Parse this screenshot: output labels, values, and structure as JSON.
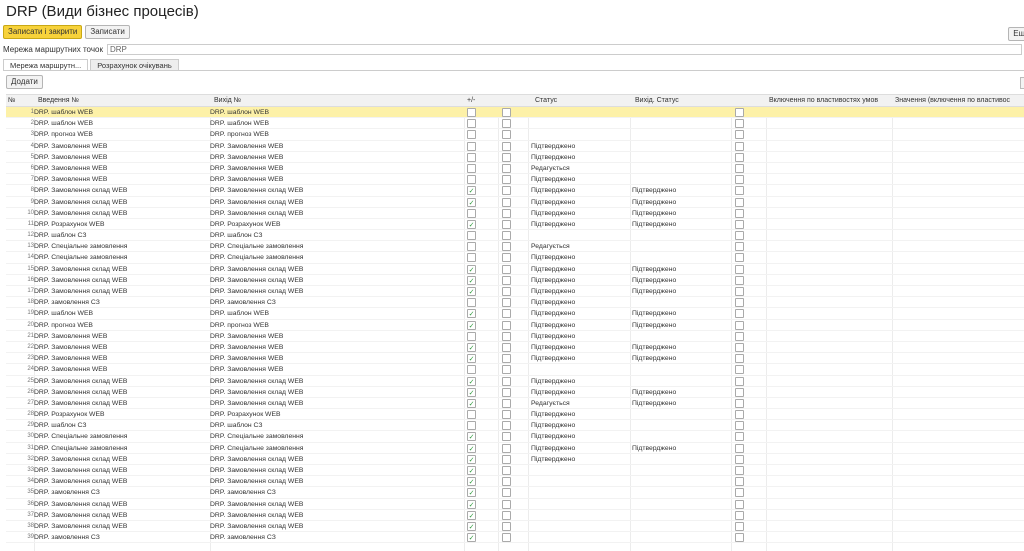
{
  "window": {
    "title": "DRP (Види бізнес процесів)"
  },
  "toolbar": {
    "save_close": "Записати і закрити",
    "save": "Записати",
    "right_button": "Еш"
  },
  "route_network": {
    "label": "Мережа маршрутних точок",
    "value": "DRP"
  },
  "tabs": [
    {
      "label": "Мережа маршрутн..."
    },
    {
      "label": "Розрахунок очікувань"
    }
  ],
  "add_button": "Додати",
  "columns": {
    "num": "№",
    "input": "Введення №",
    "output": "Вихід №",
    "c1": "+/-",
    "c2": "",
    "status": "Статус",
    "exit_status": "Вихід. Статус",
    "c3": "",
    "incl": "Включення по властивостях умов",
    "val": "Значення (включення по властивос"
  },
  "rows": [
    {
      "n": "1",
      "in": "DRP. шаблон WEB",
      "out": "DRP. шаблон WEB",
      "c1": false,
      "st": "",
      "ex": ""
    },
    {
      "n": "2",
      "in": "DRP. шаблон WEB",
      "out": "DRP. шаблон WEB",
      "c1": false,
      "st": "",
      "ex": ""
    },
    {
      "n": "3",
      "in": "DRP. прогноз WEB",
      "out": "DRP. прогноз WEB",
      "c1": false,
      "st": "",
      "ex": ""
    },
    {
      "n": "4",
      "in": "DRP. Замовлення WEB",
      "out": "DRP. Замовлення WEB",
      "c1": false,
      "st": "Підтверджено",
      "ex": ""
    },
    {
      "n": "5",
      "in": "DRP. Замовлення WEB",
      "out": "DRP. Замовлення WEB",
      "c1": false,
      "st": "Підтверджено",
      "ex": ""
    },
    {
      "n": "6",
      "in": "DRP. Замовлення WEB",
      "out": "DRP. Замовлення WEB",
      "c1": false,
      "st": "Редагується",
      "ex": ""
    },
    {
      "n": "7",
      "in": "DRP. Замовлення WEB",
      "out": "DRP. Замовлення WEB",
      "c1": false,
      "st": "Підтверджено",
      "ex": ""
    },
    {
      "n": "8",
      "in": "DRP. Замовлення склад WEB",
      "out": "DRP. Замовлення склад WEB",
      "c1": true,
      "st": "Підтверджено",
      "ex": "Підтверджено"
    },
    {
      "n": "9",
      "in": "DRP. Замовлення склад WEB",
      "out": "DRP. Замовлення склад WEB",
      "c1": true,
      "st": "Підтверджено",
      "ex": "Підтверджено"
    },
    {
      "n": "10",
      "in": "DRP. Замовлення склад WEB",
      "out": "DRP. Замовлення склад WEB",
      "c1": false,
      "st": "Підтверджено",
      "ex": "Підтверджено"
    },
    {
      "n": "11",
      "in": "DRP. Розрахунок WEB",
      "out": "DRP. Розрахунок WEB",
      "c1": true,
      "st": "Підтверджено",
      "ex": "Підтверджено"
    },
    {
      "n": "12",
      "in": "DRP. шаблон СЗ",
      "out": "DRP. шаблон СЗ",
      "c1": false,
      "st": "",
      "ex": ""
    },
    {
      "n": "13",
      "in": "DRP. Спеціальне замовлення",
      "out": "DRP. Спеціальне замовлення",
      "c1": false,
      "st": "Редагується",
      "ex": ""
    },
    {
      "n": "14",
      "in": "DRP. Спеціальне замовлення",
      "out": "DRP. Спеціальне замовлення",
      "c1": false,
      "st": "Підтверджено",
      "ex": ""
    },
    {
      "n": "15",
      "in": "DRP. Замовлення склад WEB",
      "out": "DRP. Замовлення склад WEB",
      "c1": true,
      "st": "Підтверджено",
      "ex": "Підтверджено"
    },
    {
      "n": "16",
      "in": "DRP. Замовлення склад WEB",
      "out": "DRP. Замовлення склад WEB",
      "c1": true,
      "st": "Підтверджено",
      "ex": "Підтверджено"
    },
    {
      "n": "17",
      "in": "DRP. Замовлення склад WEB",
      "out": "DRP. Замовлення склад WEB",
      "c1": true,
      "st": "Підтверджено",
      "ex": "Підтверджено"
    },
    {
      "n": "18",
      "in": "DRP. замовлення СЗ",
      "out": "DRP. замовлення СЗ",
      "c1": false,
      "st": "Підтверджено",
      "ex": ""
    },
    {
      "n": "19",
      "in": "DRP. шаблон WEB",
      "out": "DRP. шаблон WEB",
      "c1": true,
      "st": "Підтверджено",
      "ex": "Підтверджено"
    },
    {
      "n": "20",
      "in": "DRP. прогноз WEB",
      "out": "DRP. прогноз WEB",
      "c1": true,
      "st": "Підтверджено",
      "ex": "Підтверджено"
    },
    {
      "n": "21",
      "in": "DRP. Замовлення WEB",
      "out": "DRP. Замовлення WEB",
      "c1": false,
      "st": "Підтверджено",
      "ex": ""
    },
    {
      "n": "22",
      "in": "DRP. Замовлення WEB",
      "out": "DRP. Замовлення WEB",
      "c1": true,
      "st": "Підтверджено",
      "ex": "Підтверджено"
    },
    {
      "n": "23",
      "in": "DRP. Замовлення WEB",
      "out": "DRP. Замовлення WEB",
      "c1": true,
      "st": "Підтверджено",
      "ex": "Підтверджено"
    },
    {
      "n": "24",
      "in": "DRP. Замовлення WEB",
      "out": "DRP. Замовлення WEB",
      "c1": false,
      "st": "",
      "ex": ""
    },
    {
      "n": "25",
      "in": "DRP. Замовлення склад WEB",
      "out": "DRP. Замовлення склад WEB",
      "c1": true,
      "st": "Підтверджено",
      "ex": ""
    },
    {
      "n": "26",
      "in": "DRP. Замовлення склад WEB",
      "out": "DRP. Замовлення склад WEB",
      "c1": true,
      "st": "Підтверджено",
      "ex": "Підтверджено"
    },
    {
      "n": "27",
      "in": "DRP. Замовлення склад WEB",
      "out": "DRP. Замовлення склад WEB",
      "c1": true,
      "st": "Редагується",
      "ex": "Підтверджено"
    },
    {
      "n": "28",
      "in": "DRP. Розрахунок WEB",
      "out": "DRP. Розрахунок WEB",
      "c1": false,
      "st": "Підтверджено",
      "ex": ""
    },
    {
      "n": "29",
      "in": "DRP. шаблон СЗ",
      "out": "DRP. шаблон СЗ",
      "c1": false,
      "st": "Підтверджено",
      "ex": ""
    },
    {
      "n": "30",
      "in": "DRP. Спеціальне замовлення",
      "out": "DRP. Спеціальне замовлення",
      "c1": true,
      "st": "Підтверджено",
      "ex": ""
    },
    {
      "n": "31",
      "in": "DRP. Спеціальне замовлення",
      "out": "DRP. Спеціальне замовлення",
      "c1": true,
      "st": "Підтверджено",
      "ex": "Підтверджено"
    },
    {
      "n": "32",
      "in": "DRP. Замовлення склад WEB",
      "out": "DRP. Замовлення склад WEB",
      "c1": true,
      "st": "Підтверджено",
      "ex": ""
    },
    {
      "n": "33",
      "in": "DRP. Замовлення склад WEB",
      "out": "DRP. Замовлення склад WEB",
      "c1": true,
      "st": "",
      "ex": ""
    },
    {
      "n": "34",
      "in": "DRP. Замовлення склад WEB",
      "out": "DRP. Замовлення склад WEB",
      "c1": true,
      "st": "",
      "ex": ""
    },
    {
      "n": "35",
      "in": "DRP. замовлення СЗ",
      "out": "DRP. замовлення СЗ",
      "c1": true,
      "st": "",
      "ex": ""
    },
    {
      "n": "36",
      "in": "DRP. Замовлення склад WEB",
      "out": "DRP. Замовлення склад WEB",
      "c1": true,
      "st": "",
      "ex": ""
    },
    {
      "n": "37",
      "in": "DRP. Замовлення склад WEB",
      "out": "DRP. Замовлення склад WEB",
      "c1": true,
      "st": "",
      "ex": ""
    },
    {
      "n": "38",
      "in": "DRP. Замовлення склад WEB",
      "out": "DRP. Замовлення склад WEB",
      "c1": true,
      "st": "",
      "ex": ""
    },
    {
      "n": "39",
      "in": "DRP. замовлення СЗ",
      "out": "DRP. замовлення СЗ",
      "c1": true,
      "st": "",
      "ex": ""
    }
  ]
}
